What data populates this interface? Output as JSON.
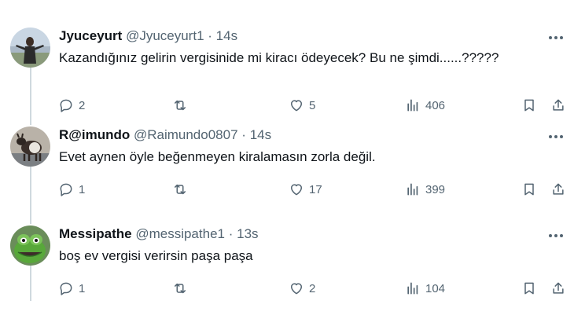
{
  "tweets": [
    {
      "name": "Jyuceyurt",
      "handle": "@Jyuceyurt1",
      "sep": "·",
      "time": "14s",
      "text": "Kazandığınız gelirin vergisinide mi kiracı ödeyecek? Bu ne şimdi......?????",
      "replies": "2",
      "retweets": "",
      "likes": "5",
      "views": "406",
      "avatar_icon": "avatar-photo-person-outdoors"
    },
    {
      "name": "R@imundo",
      "handle": "@Raimundo0807",
      "sep": "·",
      "time": "14s",
      "text": "Evet aynen öyle beğenmeyen kiralamasın zorla değil.",
      "replies": "1",
      "retweets": "",
      "likes": "17",
      "views": "399",
      "avatar_icon": "avatar-photo-goat"
    },
    {
      "name": "Messipathe",
      "handle": "@messipathe1",
      "sep": "·",
      "time": "13s",
      "text": "boş ev vergisi verirsin paşa paşa",
      "replies": "1",
      "retweets": "",
      "likes": "2",
      "views": "104",
      "avatar_icon": "avatar-photo-kermit-frog"
    }
  ],
  "colors": {
    "text": "#0f1419",
    "muted": "#536471",
    "thread_line": "#cfd9de",
    "background": "#ffffff"
  }
}
